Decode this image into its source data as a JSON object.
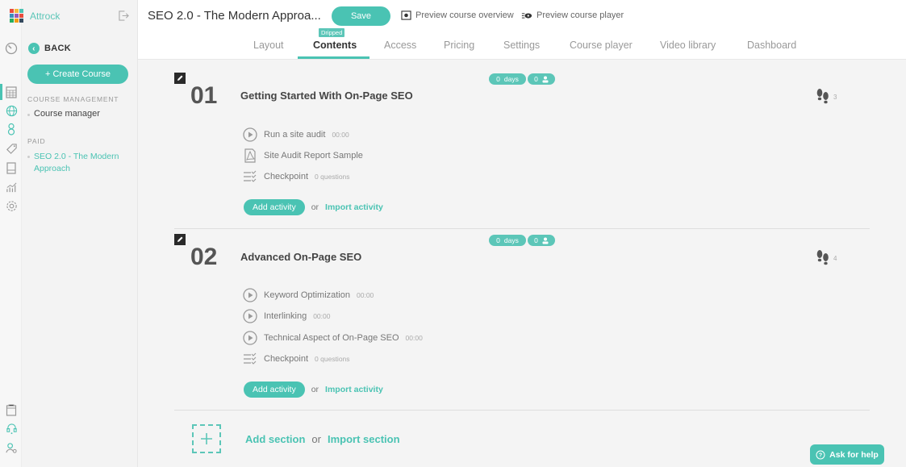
{
  "brand": {
    "name": "Attrock",
    "grid_colors": [
      "#e94b3c",
      "#f6b93b",
      "#4ac3b3",
      "#3c8dbc",
      "#9b59b6",
      "#e94b3c",
      "#27ae60",
      "#f39c12",
      "#34495e"
    ]
  },
  "colors": {
    "accent": "#4ac3b3"
  },
  "sidebar": {
    "back_label": "BACK",
    "create_label": "+ Create Course",
    "course_management_label": "COURSE MANAGEMENT",
    "course_manager_label": "Course manager",
    "paid_label": "PAID",
    "paid_course_label": "SEO 2.0 - The Modern Approach"
  },
  "header": {
    "title": "SEO 2.0 - The Modern Approa...",
    "save_label": "Save",
    "preview_overview_label": "Preview course overview",
    "preview_player_label": "Preview course player",
    "dripped_badge": "Dripped"
  },
  "tabs": [
    {
      "label": "Layout"
    },
    {
      "label": "Contents",
      "active": true
    },
    {
      "label": "Access"
    },
    {
      "label": "Pricing"
    },
    {
      "label": "Settings"
    },
    {
      "label": "Course player"
    },
    {
      "label": "Video library"
    },
    {
      "label": "Dashboard"
    }
  ],
  "sections": [
    {
      "number": "01",
      "title": "Getting Started With On-Page SEO",
      "days_value": "0",
      "days_label": "days",
      "users_value": "0",
      "steps_count": "3",
      "activities": [
        {
          "type": "video",
          "icon": "play-circle-icon",
          "label": "Run a site audit",
          "meta": "00:00"
        },
        {
          "type": "pdf",
          "icon": "pdf-icon",
          "label": "Site Audit Report Sample",
          "meta": ""
        },
        {
          "type": "quiz",
          "icon": "checklist-icon",
          "label": "Checkpoint",
          "meta": "0 questions"
        }
      ]
    },
    {
      "number": "02",
      "title": "Advanced On-Page SEO",
      "days_value": "0",
      "days_label": "days",
      "users_value": "0",
      "steps_count": "4",
      "activities": [
        {
          "type": "video",
          "icon": "play-circle-icon",
          "label": "Keyword Optimization",
          "meta": "00:00"
        },
        {
          "type": "video",
          "icon": "play-circle-icon",
          "label": "Interlinking",
          "meta": "00:00"
        },
        {
          "type": "video",
          "icon": "play-circle-icon",
          "label": "Technical Aspect of On-Page SEO",
          "meta": "00:00"
        },
        {
          "type": "quiz",
          "icon": "checklist-icon",
          "label": "Checkpoint",
          "meta": "0 questions"
        }
      ]
    }
  ],
  "actions": {
    "add_activity": "Add activity",
    "or": "or",
    "import_activity": "Import activity",
    "add_section": "Add section",
    "import_section": "Import section"
  },
  "help": {
    "label": "Ask for help"
  }
}
